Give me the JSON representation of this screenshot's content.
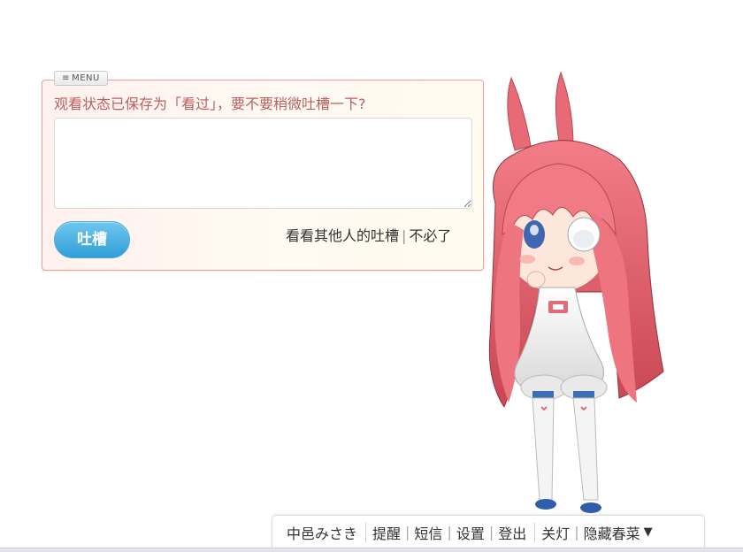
{
  "dialog": {
    "menu_label": "MENU",
    "prompt": "观看状态已保存为「看过」，要不要稍微吐槽一下?",
    "comment_value": "",
    "submit_label": "吐槽",
    "view_others_link": "看看其他人的吐槽",
    "separator": "|",
    "dismiss_link": "不必了"
  },
  "toolbar": {
    "username": "中邑みさき",
    "items": [
      "提醒",
      "短信",
      "设置",
      "登出"
    ],
    "lights_label": "关灯",
    "hide_label": "隐藏春菜",
    "arrow": "▼"
  },
  "colors": {
    "bubble_border": "#e6a0a0",
    "prompt_text": "#b86060",
    "submit_button": "#2f9fd6",
    "character_hair": "#ee7b86"
  }
}
